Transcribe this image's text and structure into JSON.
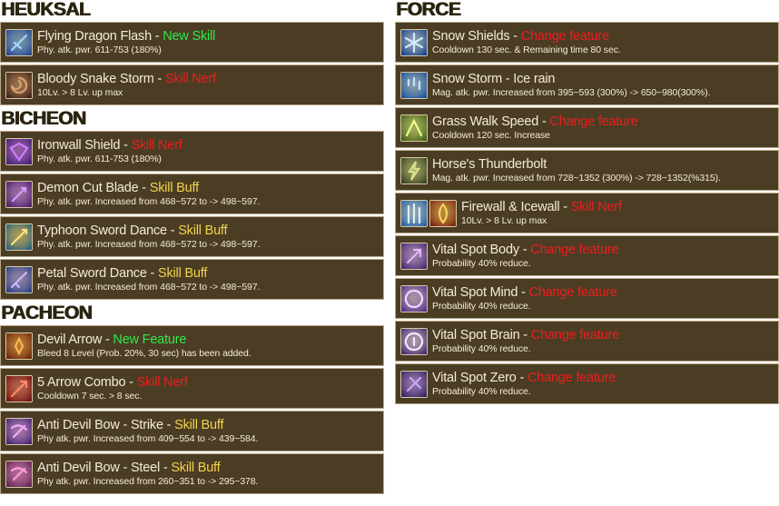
{
  "colors": {
    "green": "#2ee94c",
    "red": "#ee1d1d",
    "yellow": "#f3d24a",
    "row_bg": "#4b3d24"
  },
  "left": {
    "sections": [
      {
        "heading": "HEUKSAL",
        "rows": [
          {
            "title": "Flying Dragon Flash - ",
            "tag": "New Skill",
            "tag_color": "green",
            "desc": "Phy. atk. pwr. 611-753 (180%)",
            "icons": [
              "dragon-flash-icon"
            ]
          },
          {
            "title": "Bloody Snake Storm - ",
            "tag": "Skill Nerf",
            "tag_color": "red",
            "desc": "10Lv. > 8 Lv. up max",
            "icons": [
              "snake-storm-icon"
            ]
          }
        ]
      },
      {
        "heading": "BICHEON",
        "rows": [
          {
            "title": "Ironwall Shield - ",
            "tag": "Skill Nerf",
            "tag_color": "red",
            "desc": "Phy. atk. pwr. 611-753 (180%)",
            "icons": [
              "ironwall-shield-icon"
            ]
          },
          {
            "title": "Demon Cut Blade - ",
            "tag": "Skill Buff",
            "tag_color": "yellow",
            "desc": "Phy. atk. pwr. Increased from 468~572 to -> 498~597.",
            "icons": [
              "demon-blade-icon"
            ]
          },
          {
            "title": "Typhoon Sword Dance - ",
            "tag": "Skill Buff",
            "tag_color": "yellow",
            "desc": "Phy. atk. pwr. Increased from 468~572 to -> 498~597.",
            "icons": [
              "typhoon-sword-icon"
            ]
          },
          {
            "title": "Petal Sword Dance - ",
            "tag": "Skill Buff",
            "tag_color": "yellow",
            "desc": "Phy. atk. pwr. Increased from 468~572 to -> 498~597.",
            "icons": [
              "petal-sword-icon"
            ]
          }
        ]
      },
      {
        "heading": "PACHEON",
        "rows": [
          {
            "title": "Devil Arrow - ",
            "tag": "New Feature",
            "tag_color": "green",
            "desc": "Bleed 8 Level (Prob. 20%, 30 sec) has been added.",
            "icons": [
              "devil-arrow-icon"
            ]
          },
          {
            "title": "5 Arrow Combo - ",
            "tag": "Skill Nerf",
            "tag_color": "red",
            "desc": "Cooldown 7 sec. > 8 sec.",
            "icons": [
              "arrow-combo-icon"
            ]
          },
          {
            "title": "Anti Devil Bow - Strike - ",
            "tag": "Skill Buff",
            "tag_color": "yellow",
            "desc": "Phy atk. pwr. Increased from 409~554 to -> 439~584.",
            "icons": [
              "bow-strike-icon"
            ]
          },
          {
            "title": "Anti Devil Bow - Steel - ",
            "tag": "Skill Buff",
            "tag_color": "yellow",
            "desc": "Phy atk. pwr. Increased from 260~351 to -> 295~378.",
            "icons": [
              "bow-steel-icon"
            ]
          }
        ]
      }
    ]
  },
  "right": {
    "heading": "FORCE",
    "rows": [
      {
        "title": "Snow Shields - ",
        "tag": "Change feature",
        "tag_color": "red",
        "desc": "Cooldown 130 sec. & Remaining time 80 sec.",
        "icons": [
          "snow-shield-icon"
        ]
      },
      {
        "title": "Snow Storm - Ice rain",
        "tag": "",
        "tag_color": "red",
        "desc": "Mag. atk. pwr. Increased from 395~593 (300%) -> 650~980(300%).",
        "icons": [
          "ice-rain-icon"
        ]
      },
      {
        "title": "Grass Walk Speed - ",
        "tag": "Change feature",
        "tag_color": "red",
        "desc": "Cooldown 120 sec. Increase",
        "icons": [
          "grass-walk-icon"
        ]
      },
      {
        "title": "Horse's Thunderbolt",
        "tag": "",
        "tag_color": "red",
        "desc": "Mag. atk. pwr. Increased from 728~1352 (300%) -> 728~1352(%315).",
        "icons": [
          "thunderbolt-icon"
        ]
      },
      {
        "title": "Firewall & Icewall - ",
        "tag": "Skill Nerf",
        "tag_color": "red",
        "desc": "10Lv. > 8 Lv. up max",
        "icons": [
          "icewall-icon",
          "firewall-icon"
        ]
      },
      {
        "title": "Vital Spot Body - ",
        "tag": "Change feature",
        "tag_color": "red",
        "desc": "Probability 40% reduce.",
        "icons": [
          "vital-body-icon"
        ]
      },
      {
        "title": "Vital Spot Mind - ",
        "tag": "Change feature",
        "tag_color": "red",
        "desc": "Probability 40% reduce.",
        "icons": [
          "vital-mind-icon"
        ]
      },
      {
        "title": "Vital Spot Brain - ",
        "tag": "Change feature",
        "tag_color": "red",
        "desc": "Probability 40% reduce.",
        "icons": [
          "vital-brain-icon"
        ]
      },
      {
        "title": "Vital Spot Zero - ",
        "tag": "Change feature",
        "tag_color": "red",
        "desc": "Probability 40% reduce.",
        "icons": [
          "vital-zero-icon"
        ]
      }
    ]
  }
}
